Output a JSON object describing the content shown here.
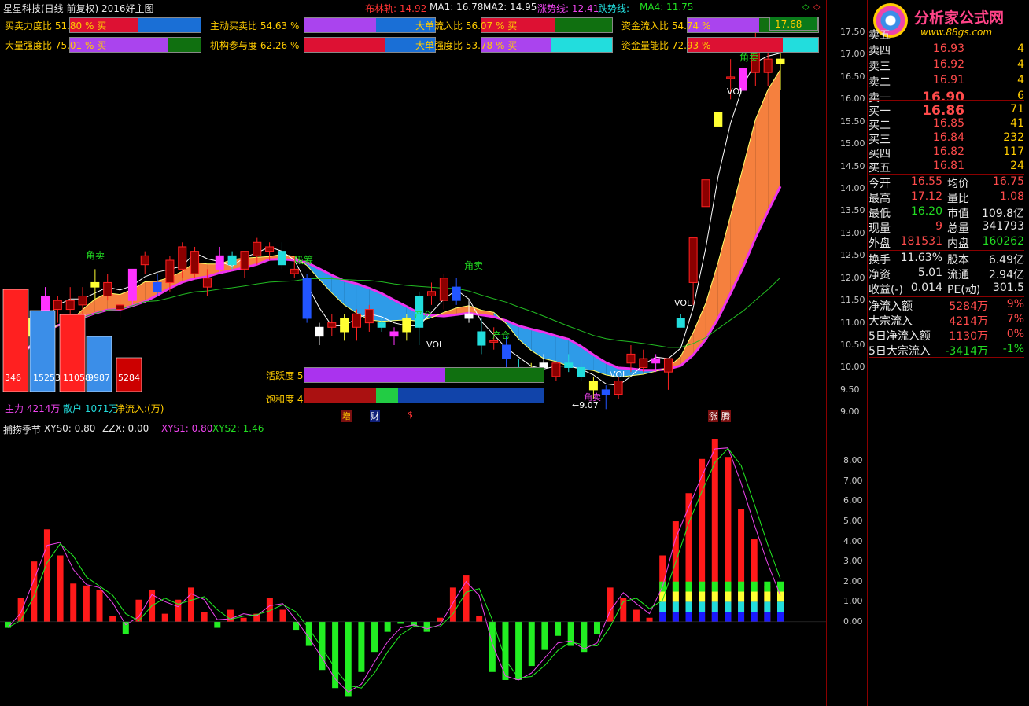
{
  "header": {
    "title": "星星科技(日线 前复权) 2016好主图",
    "boll": "布林轨: 14.92",
    "ma1": "MA1: 16.78",
    "ma2": "MA2: 14.95",
    "up_line": "涨势线: 12.41",
    "down_line": "跌势线: -",
    "ma4": "MA4: 11.75"
  },
  "ratios": [
    {
      "label": "买卖力度比",
      "value": "51.80 % 买",
      "fill": 0.518,
      "c1": "#dd1133",
      "c2": "#1a6fd6"
    },
    {
      "label": "主动买卖比",
      "value": "54.63 %",
      "fill": 0.546,
      "c1": "#aa44ee",
      "c2": "#1a6fd6"
    },
    {
      "label": "大单流入比",
      "value": "56.07 % 买",
      "fill": 0.561,
      "c1": "#dd1133",
      "c2": "#107010"
    },
    {
      "label": "资金流入比",
      "value": "54.74 %",
      "fill": 0.547,
      "c1": "#aa44ee",
      "c2": "#107010"
    },
    {
      "label": "大量强度比",
      "value": "75.01 % 买",
      "fill": 0.75,
      "c1": "#aa44ee",
      "c2": "#107010"
    },
    {
      "label": "机构参与度",
      "value": "62.26 %",
      "fill": 0.623,
      "c1": "#dd1133",
      "c2": "#1a6fd6"
    },
    {
      "label": "大单强度比",
      "value": "53.78 % 买",
      "fill": 0.538,
      "c1": "#aa44ee",
      "c2": "#22dddd"
    },
    {
      "label": "资金量能比",
      "value": "72.93 %",
      "fill": 0.729,
      "c1": "#dd1133",
      "c2": "#22dddd"
    }
  ],
  "price_tag": "17.68",
  "activity": {
    "label": "活跃度",
    "value": "58.76 %",
    "fill": 0.588
  },
  "saturation": {
    "label": "饱和度",
    "value": "41.14 %",
    "fill": 0.411
  },
  "money_flow": {
    "values": [
      "346",
      "15253",
      "11058",
      "9987",
      "5284"
    ],
    "main_label": "主力 4214万",
    "retail_label": "散户 1071万",
    "net_label": "净流入:(万)"
  },
  "signals": {
    "jiao_mai_1": "角卖",
    "jiao_mai_2": "角卖",
    "jiao_mai_3": "角卖",
    "xi_qian": "吸筹",
    "chan_cang_1": "产仓",
    "chan_cang_2": "产仓",
    "vol_1": "VOL",
    "vol_2": "VOL",
    "vol_3": "VOL",
    "vol_4": "VOL",
    "low_mark": "9.07",
    "zeng": "增",
    "cai": "财",
    "zhang": "涨",
    "teng": "腾",
    "jiao_mai_low": "角卖"
  },
  "osc": {
    "title": "捕捞季节",
    "xys0": "XYS0: 0.80",
    "zzx": "ZZX: 0.00",
    "xys1": "XYS1: 0.80",
    "xys2": "XYS2: 1.46"
  },
  "price_axis": [
    "17.50",
    "17.00",
    "16.50",
    "16.00",
    "15.50",
    "15.00",
    "14.50",
    "14.00",
    "13.50",
    "13.00",
    "12.50",
    "12.00",
    "11.50",
    "11.00",
    "10.50",
    "10.00",
    "9.50",
    "9.00"
  ],
  "osc_axis": [
    "8.00",
    "7.00",
    "6.00",
    "5.00",
    "4.00",
    "3.00",
    "2.00",
    "1.00",
    "0.00"
  ],
  "quote": {
    "asks": [
      {
        "name": "卖五",
        "price": "",
        "vol": ""
      },
      {
        "name": "卖四",
        "price": "16.93",
        "vol": "4"
      },
      {
        "name": "卖三",
        "price": "16.92",
        "vol": "4"
      },
      {
        "name": "卖二",
        "price": "16.91",
        "vol": "4"
      },
      {
        "name": "卖一",
        "price": "16.90",
        "vol": "6"
      }
    ],
    "bids": [
      {
        "name": "买一",
        "price": "16.86",
        "vol": "71"
      },
      {
        "name": "买二",
        "price": "16.85",
        "vol": "41"
      },
      {
        "name": "买三",
        "price": "16.84",
        "vol": "232"
      },
      {
        "name": "买四",
        "price": "16.82",
        "vol": "117"
      },
      {
        "name": "买五",
        "price": "16.81",
        "vol": "24"
      }
    ],
    "stats": [
      {
        "l1": "今开",
        "v1": "16.55",
        "c1": "#ff4b4b",
        "l2": "均价",
        "v2": "16.75",
        "c2": "#ff4b4b"
      },
      {
        "l1": "最高",
        "v1": "17.12",
        "c1": "#ff4b4b",
        "l2": "量比",
        "v2": "1.08",
        "c2": "#ff4b4b"
      },
      {
        "l1": "最低",
        "v1": "16.20",
        "c1": "#22dd22",
        "l2": "市值",
        "v2": "109.8亿",
        "c2": "#e8e8e8"
      },
      {
        "l1": "现量",
        "v1": "9",
        "c1": "#ff4b4b",
        "l2": "总量",
        "v2": "341793",
        "c2": "#e8e8e8"
      },
      {
        "l1": "外盘",
        "v1": "181531",
        "c1": "#ff4b4b",
        "l2": "内盘",
        "v2": "160262",
        "c2": "#22dd22"
      }
    ],
    "stats2": [
      {
        "l1": "换手",
        "v1": "11.63%",
        "c1": "#e8e8e8",
        "l2": "股本",
        "v2": "6.49亿",
        "c2": "#e8e8e8"
      },
      {
        "l1": "净资",
        "v1": "5.01",
        "c1": "#e8e8e8",
        "l2": "流通",
        "v2": "2.94亿",
        "c2": "#e8e8e8"
      },
      {
        "l1": "收益(-)",
        "v1": "0.014",
        "c1": "#e8e8e8",
        "l2": "PE(动)",
        "v2": "301.5",
        "c2": "#e8e8e8"
      }
    ],
    "flows": [
      {
        "name": "净流入额",
        "value": "5284万",
        "pct": "9%",
        "color": "#ff4b4b"
      },
      {
        "name": "大宗流入",
        "value": "4214万",
        "pct": "7%",
        "color": "#ff4b4b"
      },
      {
        "name": "5日净流入额",
        "value": "1130万",
        "pct": "0%",
        "color": "#ff4b4b"
      },
      {
        "name": "5日大宗流入",
        "value": "-3414万",
        "pct": "-1%",
        "color": "#22dd22"
      }
    ]
  },
  "logo": {
    "text": "分析家公式网",
    "url": "www.88gs.com"
  },
  "chart_data": [
    {
      "type": "candlestick",
      "ylim": [
        8.9,
        17.8
      ],
      "candles": [
        {
          "o": 10.2,
          "h": 10.7,
          "l": 9.9,
          "c": 10.0
        },
        {
          "o": 10.3,
          "h": 10.6,
          "l": 10.0,
          "c": 10.5
        },
        {
          "o": 10.7,
          "h": 11.2,
          "l": 10.5,
          "c": 11.1
        },
        {
          "o": 11.2,
          "h": 11.8,
          "l": 11.0,
          "c": 11.6
        },
        {
          "o": 11.3,
          "h": 11.6,
          "l": 11.0,
          "c": 11.5
        },
        {
          "o": 11.3,
          "h": 11.8,
          "l": 11.2,
          "c": 11.5
        },
        {
          "o": 11.4,
          "h": 11.8,
          "l": 11.2,
          "c": 11.6
        },
        {
          "o": 11.8,
          "h": 12.2,
          "l": 11.5,
          "c": 11.9
        },
        {
          "o": 11.6,
          "h": 12.1,
          "l": 11.5,
          "c": 11.9
        },
        {
          "o": 11.3,
          "h": 11.5,
          "l": 11.1,
          "c": 11.4
        },
        {
          "o": 11.5,
          "h": 12.2,
          "l": 11.4,
          "c": 12.2
        },
        {
          "o": 12.3,
          "h": 12.6,
          "l": 12.1,
          "c": 12.5
        },
        {
          "o": 11.9,
          "h": 12.1,
          "l": 11.6,
          "c": 11.7
        },
        {
          "o": 11.9,
          "h": 12.5,
          "l": 11.7,
          "c": 12.4
        },
        {
          "o": 12.2,
          "h": 12.8,
          "l": 12.0,
          "c": 12.7
        },
        {
          "o": 12.1,
          "h": 12.7,
          "l": 12.0,
          "c": 12.6
        },
        {
          "o": 11.8,
          "h": 12.2,
          "l": 11.6,
          "c": 12.0
        },
        {
          "o": 12.2,
          "h": 12.7,
          "l": 12.1,
          "c": 12.5
        },
        {
          "o": 12.5,
          "h": 12.6,
          "l": 12.2,
          "c": 12.3
        },
        {
          "o": 12.2,
          "h": 12.6,
          "l": 12.0,
          "c": 12.6
        },
        {
          "o": 12.5,
          "h": 12.9,
          "l": 12.3,
          "c": 12.8
        },
        {
          "o": 12.6,
          "h": 12.8,
          "l": 12.4,
          "c": 12.7
        },
        {
          "o": 12.6,
          "h": 12.8,
          "l": 12.2,
          "c": 12.3
        },
        {
          "o": 12.1,
          "h": 12.5,
          "l": 12.0,
          "c": 12.2
        },
        {
          "o": 12.0,
          "h": 12.1,
          "l": 11.0,
          "c": 11.1
        },
        {
          "o": 10.9,
          "h": 11.0,
          "l": 10.5,
          "c": 10.7
        },
        {
          "o": 10.9,
          "h": 11.2,
          "l": 10.7,
          "c": 11.0
        },
        {
          "o": 10.8,
          "h": 11.2,
          "l": 10.6,
          "c": 11.1
        },
        {
          "o": 10.9,
          "h": 11.3,
          "l": 10.6,
          "c": 11.2
        },
        {
          "o": 11.0,
          "h": 11.4,
          "l": 10.8,
          "c": 11.3
        },
        {
          "o": 11.0,
          "h": 11.1,
          "l": 10.8,
          "c": 10.9
        },
        {
          "o": 10.7,
          "h": 10.9,
          "l": 10.5,
          "c": 10.8
        },
        {
          "o": 10.8,
          "h": 11.2,
          "l": 10.6,
          "c": 11.1
        },
        {
          "o": 11.6,
          "h": 11.7,
          "l": 10.5,
          "c": 10.9
        },
        {
          "o": 11.6,
          "h": 11.9,
          "l": 11.4,
          "c": 11.7
        },
        {
          "o": 11.5,
          "h": 12.1,
          "l": 11.3,
          "c": 12.0
        },
        {
          "o": 11.8,
          "h": 12.0,
          "l": 11.4,
          "c": 11.5
        },
        {
          "o": 11.2,
          "h": 11.5,
          "l": 11.0,
          "c": 11.1
        },
        {
          "o": 10.8,
          "h": 11.1,
          "l": 10.3,
          "c": 10.5
        },
        {
          "o": 10.6,
          "h": 10.9,
          "l": 10.4,
          "c": 10.6
        },
        {
          "o": 10.5,
          "h": 10.7,
          "l": 10.0,
          "c": 10.2
        },
        {
          "o": 10.0,
          "h": 10.2,
          "l": 9.7,
          "c": 9.9
        },
        {
          "o": 10.0,
          "h": 10.1,
          "l": 9.9,
          "c": 10.0
        },
        {
          "o": 10.1,
          "h": 10.3,
          "l": 9.8,
          "c": 10.0
        },
        {
          "o": 9.8,
          "h": 10.1,
          "l": 9.7,
          "c": 10.1
        },
        {
          "o": 10.1,
          "h": 10.3,
          "l": 9.9,
          "c": 10.0
        },
        {
          "o": 10.0,
          "h": 10.2,
          "l": 9.7,
          "c": 9.8
        },
        {
          "o": 9.5,
          "h": 9.8,
          "l": 9.3,
          "c": 9.7
        },
        {
          "o": 9.5,
          "h": 9.6,
          "l": 9.07,
          "c": 9.4
        },
        {
          "o": 9.4,
          "h": 9.8,
          "l": 9.3,
          "c": 9.7
        },
        {
          "o": 10.1,
          "h": 10.5,
          "l": 9.9,
          "c": 10.3
        },
        {
          "o": 10.0,
          "h": 10.4,
          "l": 9.9,
          "c": 10.2
        },
        {
          "o": 10.1,
          "h": 10.3,
          "l": 9.9,
          "c": 10.2
        },
        {
          "o": 9.9,
          "h": 10.1,
          "l": 9.5,
          "c": 10.2
        },
        {
          "o": 11.1,
          "h": 11.2,
          "l": 10.9,
          "c": 10.9
        },
        {
          "o": 11.9,
          "h": 12.9,
          "l": 11.4,
          "c": 12.9
        },
        {
          "o": 13.6,
          "h": 14.2,
          "l": 13.6,
          "c": 14.2
        },
        {
          "o": 15.4,
          "h": 15.7,
          "l": 15.4,
          "c": 15.7
        },
        {
          "o": 16.5,
          "h": 16.9,
          "l": 16.0,
          "c": 16.5
        },
        {
          "o": 16.2,
          "h": 16.8,
          "l": 16.2,
          "c": 16.7
        },
        {
          "o": 16.6,
          "h": 17.68,
          "l": 16.3,
          "c": 17.3
        },
        {
          "o": 16.6,
          "h": 17.2,
          "l": 16.3,
          "c": 16.9
        },
        {
          "o": 16.8,
          "h": 17.1,
          "l": 16.2,
          "c": 16.9
        }
      ]
    },
    {
      "type": "bar",
      "title": "捕捞季节",
      "ylim": [
        -3.8,
        9.5
      ],
      "values": [
        -0.3,
        1.2,
        3.0,
        4.6,
        3.3,
        1.9,
        1.8,
        1.6,
        0.3,
        -0.6,
        1.1,
        1.6,
        0.4,
        1.1,
        1.7,
        0.5,
        -0.3,
        0.6,
        0.2,
        0.4,
        1.2,
        0.6,
        -0.4,
        -1.2,
        -2.4,
        -3.3,
        -3.7,
        -2.5,
        -1.5,
        -0.5,
        -0.1,
        -0.2,
        -0.5,
        0.2,
        1.7,
        2.3,
        0.3,
        -2.5,
        -2.9,
        -2.9,
        -2.2,
        -1.4,
        -0.7,
        -1.2,
        -1.5,
        -0.6,
        1.7,
        1.2,
        0.6,
        0.2,
        3.3,
        5.0,
        6.4,
        8.1,
        9.1,
        8.2,
        5.6,
        4.1,
        1.8,
        0.8
      ],
      "stacked_last": 10
    }
  ]
}
